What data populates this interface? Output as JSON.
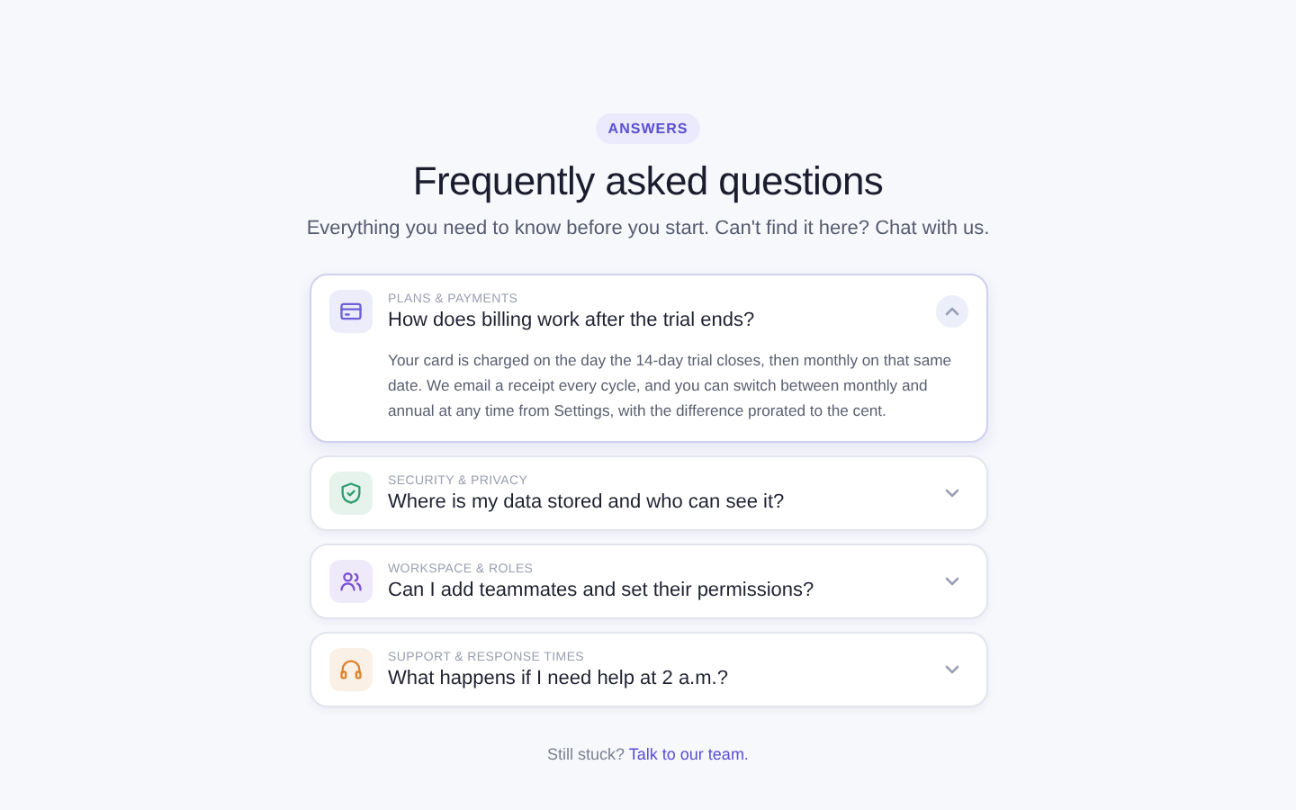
{
  "badge": "ANSWERS",
  "title": "Frequently asked questions",
  "subtitle": "Everything you need to know before you start. Can't find it here? Chat with us.",
  "faqs": [
    {
      "category": "PLANS & PAYMENTS",
      "question": "How does billing work after the trial ends?",
      "kind": "card",
      "color": "#6d5fd6",
      "expanded": true,
      "answer": "Your card is charged on the day the 14-day trial closes, then monthly on that same date. We email a receipt every cycle, and you can switch between monthly and annual at any time from Settings, with the difference prorated to the cent."
    },
    {
      "category": "SECURITY & PRIVACY",
      "question": "Where is my data stored and who can see it?",
      "kind": "shield",
      "color": "#2f9e6e",
      "expanded": false
    },
    {
      "category": "WORKSPACE & ROLES",
      "question": "Can I add teammates and set their permissions?",
      "kind": "people",
      "color": "#7b4fd6",
      "expanded": false
    },
    {
      "category": "SUPPORT & RESPONSE TIMES",
      "question": "What happens if I need help at 2 a.m.?",
      "kind": "headset",
      "color": "#e0822a",
      "expanded": false
    }
  ],
  "footer": {
    "text": "Still stuck?",
    "link": "Talk to our team."
  }
}
